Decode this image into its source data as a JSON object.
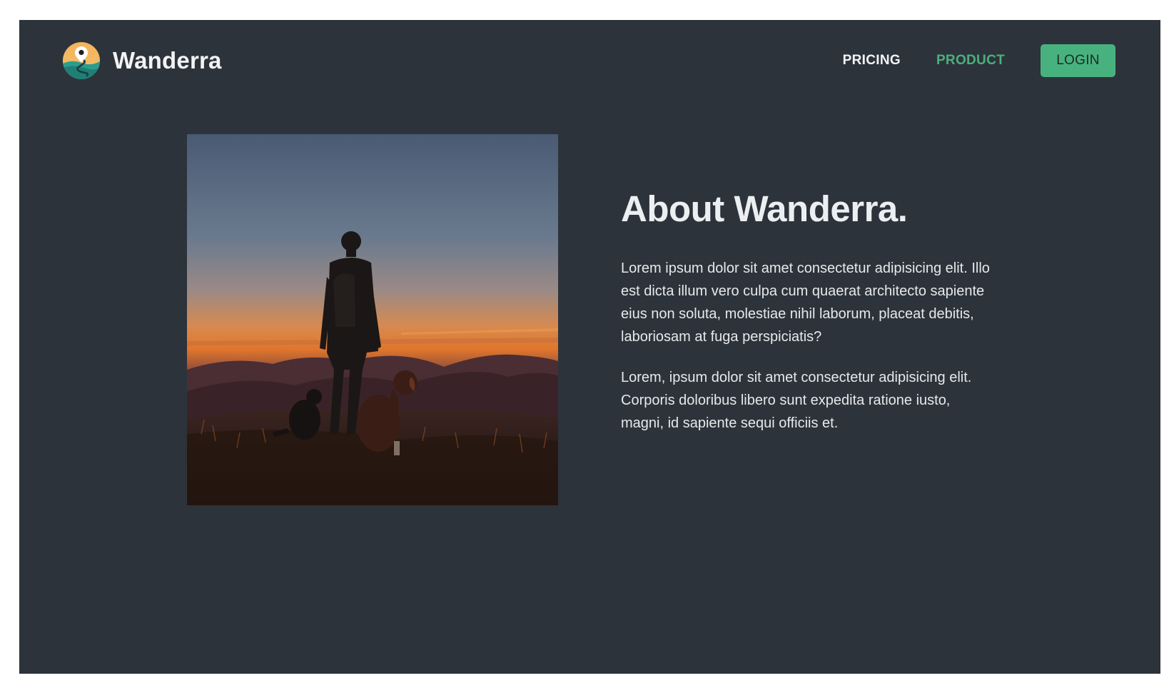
{
  "brand": {
    "name": "Wanderra",
    "logo_icon": "map-pin-path-logo-icon"
  },
  "nav": {
    "pricing_label": "PRICING",
    "product_label": "PRODUCT",
    "login_label": "LOGIN"
  },
  "hero_image": {
    "subject": "hiker-with-dogs-at-sunset-photo"
  },
  "about": {
    "title": "About Wanderra.",
    "paragraph_1": "Lorem ipsum dolor sit amet consectetur adipisicing elit. Illo est dicta illum vero culpa cum quaerat architecto sapiente eius non soluta, molestiae nihil laborum, placeat debitis, laboriosam at fuga perspiciatis?",
    "paragraph_2": "Lorem, ipsum dolor sit amet consectetur adipisicing elit. Corporis doloribus libero sunt expedita ratione iusto, magni, id sapiente sequi officiis et."
  },
  "colors": {
    "page_background": "#2d333b",
    "accent_green": "#48b27f",
    "product_link": "#4caf7d",
    "text_light": "#f1f3f4"
  }
}
